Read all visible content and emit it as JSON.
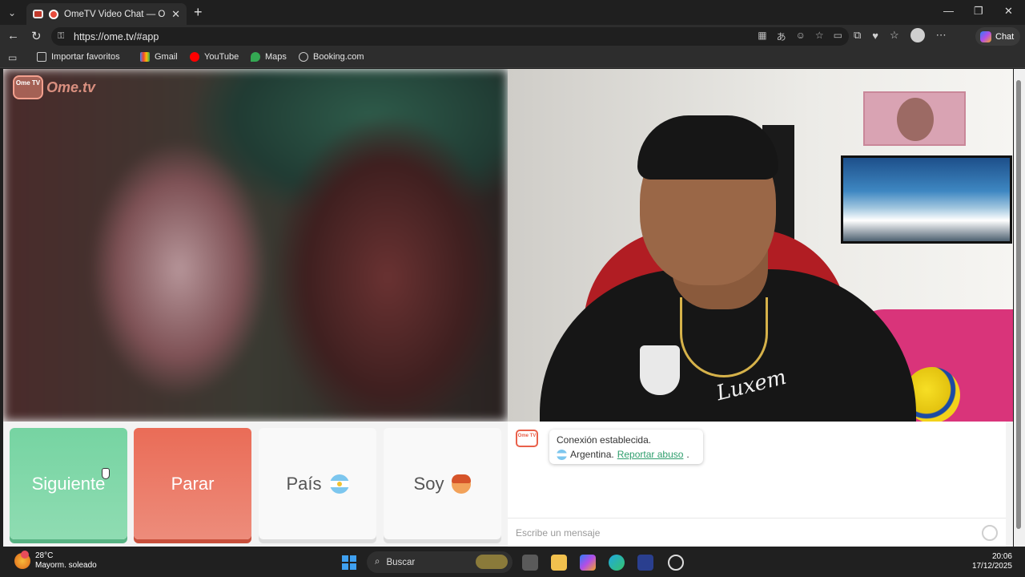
{
  "browser": {
    "tab_title": "OmeTV Video Chat — Omegl",
    "url": "https://ome.tv/#app",
    "copilot_label": "Chat",
    "bookmarks": [
      {
        "label": "Importar favoritos"
      },
      {
        "label": "Gmail"
      },
      {
        "label": "YouTube"
      },
      {
        "label": "Maps"
      },
      {
        "label": "Booking.com"
      }
    ]
  },
  "page": {
    "logo": {
      "badge": "Ome TV",
      "text": "Ome.tv"
    },
    "controls": {
      "next_label": "Siguiente",
      "stop_label": "Parar",
      "country_label": "País",
      "gender_label": "Soy"
    },
    "chat": {
      "status_line": "Conexión establecida.",
      "country": "Argentina.",
      "report_link": "Reportar abuso",
      "report_period": ".",
      "icon_text": "Ome TV",
      "input_placeholder": "Escribe un mensaje"
    },
    "remote_video": {
      "shirt_text": "Luxem"
    }
  },
  "taskbar": {
    "temperature": "28°C",
    "weather_desc": "Mayorm. soleado",
    "search_label": "Buscar",
    "time": "20:06",
    "date": "17/12/2025"
  },
  "colors": {
    "next_button": "#76d4a2",
    "stop_button": "#ea6c57",
    "report_link": "#2f9e6d",
    "logo": "#f3a08e"
  }
}
